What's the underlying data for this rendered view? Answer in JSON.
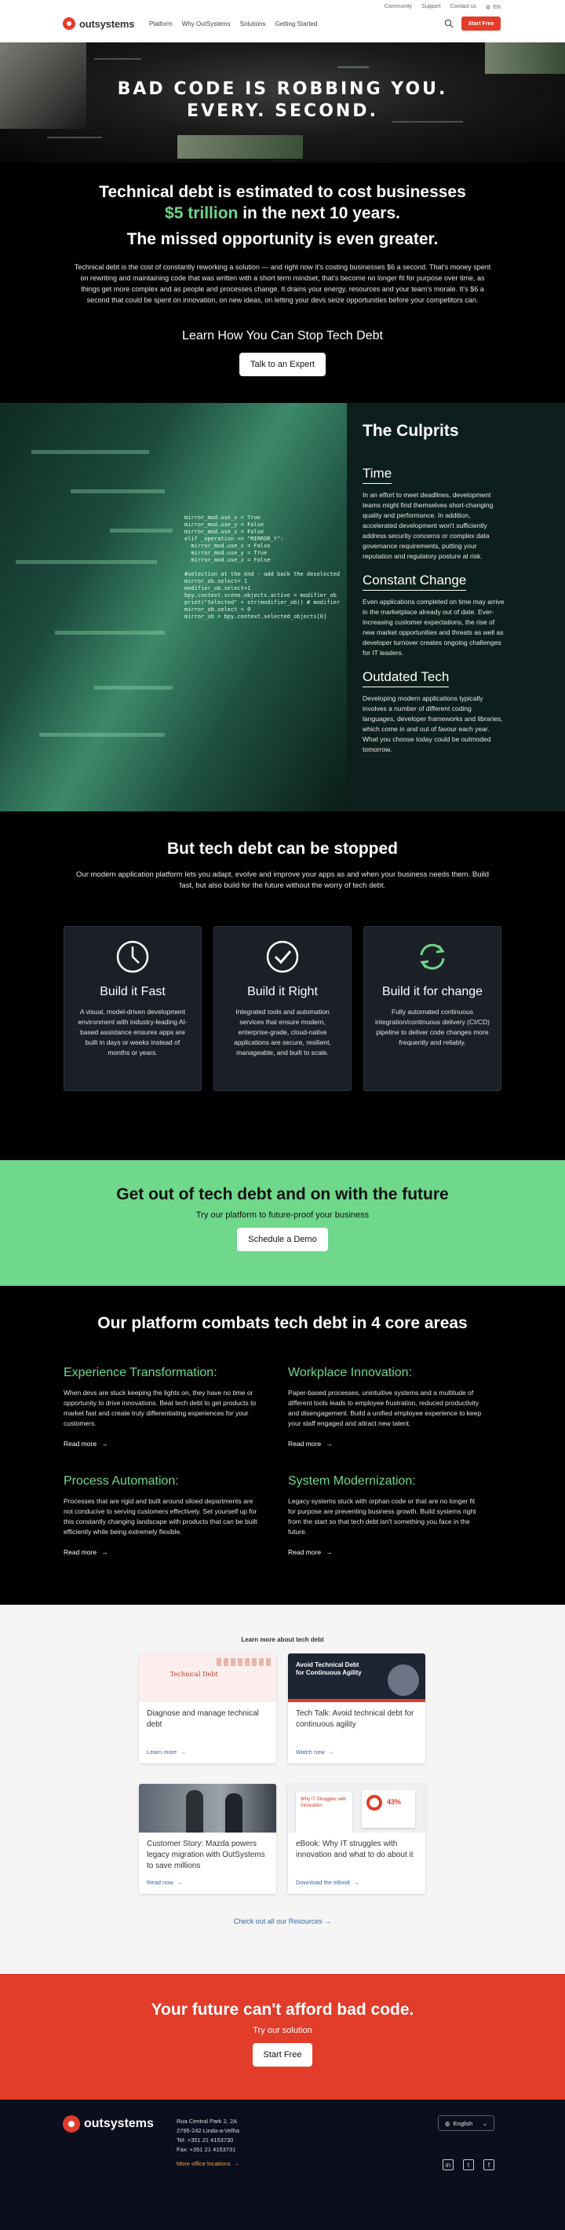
{
  "header": {
    "top_links": [
      "Community",
      "Support",
      "Contact us"
    ],
    "lang": "EN",
    "logo_text": "outsystems",
    "nav": [
      "Platform",
      "Why OutSystems",
      "Solutions",
      "Getting Started"
    ],
    "start_free": "Start Free",
    "brand_color": "#e23c2a"
  },
  "hero": {
    "line1": "BAD CODE IS ROBBING YOU.",
    "line2": "EVERY. SECOND."
  },
  "intro": {
    "headline_a": "Technical debt is estimated to cost businesses",
    "headline_amount": "$5 trillion",
    "headline_b": " in the next 10 years.",
    "subhead": "The missed opportunity is even greater.",
    "body": "Technical debt is the cost of constantly reworking a solution — and right now it's costing businesses $6 a second. That's money spent on rewriting and maintaining code that was written with a short term mindset, that's become no longer fit for purpose over time, as things get more complex and as people and processes change. It drains your energy, resources and your team's morale. It's $6 a second that could be spent on innovation, on new ideas, on letting your devs seize opportunities before your competitors can.",
    "cta_heading": "Learn How You Can Stop Tech Debt",
    "cta_button": "Talk to an Expert"
  },
  "culprits": {
    "title": "The Culprits",
    "items": [
      {
        "heading": "Time",
        "text": "In an effort to meet deadlines, development teams might find themselves short-changing quality and performance. In addition, accelerated development won't sufficiently address security concerns or complex data governance requirements, putting your reputation and regulatory posture at risk."
      },
      {
        "heading": "Constant Change",
        "text": "Even applications completed on time may arrive in the marketplace already out of date. Ever-increasing customer expectations, the rise of new market opportunities and threats as well as developer turnover creates ongoing challenges for IT leaders."
      },
      {
        "heading": "Outdated Tech",
        "text": "Developing modern applications typically involves a number of different coding languages, developer frameworks and libraries, which come in and out of favour each year. What you choose today could be outmoded tomorrow."
      }
    ],
    "code_lines": "mirror_mod.use_x = True\nmirror_mod.use_y = False\nmirror_mod.use_z = False\nelif _operation == \"MIRROR_Y\":\n  mirror_mod.use_x = False\n  mirror_mod.use_y = True\n  mirror_mod.use_z = False\n\n#selection at the end - add back the deselected\nmirror_ob.select= 1\nmodifier_ob.select=1\nbpy.context.scene.objects.active = modifier_ob\nprint(\"Selected\" + str(modifier_ob)) # modifier\nmirror_ob.select = 0\nmirror_ob = bpy.context.selected_objects[0]"
  },
  "stopped": {
    "title": "But tech debt can be stopped",
    "lead": "Our modern application platform lets you adapt, evolve and improve your apps as and when your business needs them. Build fast, but also build for the future without the worry of tech debt.",
    "cards": [
      {
        "icon": "clock-icon",
        "title": "Build it Fast",
        "text": "A visual, model-driven development environment with industry-leading AI-based assistance ensures apps are built in days or weeks instead of months or years."
      },
      {
        "icon": "checkmark-icon",
        "title": "Build it Right",
        "text": "Integrated tools and automation services that ensure modern, enterprise-grade, cloud-native applications are secure, resilient, manageable, and built to scale."
      },
      {
        "icon": "refresh-icon",
        "title": "Build it for change",
        "text": "Fully automated continuous integration/continuous delivery (CI/CD) pipeline to deliver code changes more frequently and reliably."
      }
    ]
  },
  "band": {
    "title": "Get out of tech debt and on with the future",
    "sub": "Try our platform to future-proof your business",
    "button": "Schedule a Demo",
    "color": "#6fd88b"
  },
  "core": {
    "title": "Our platform combats tech debt in 4 core areas",
    "read_more": "Read more",
    "areas": [
      {
        "title": "Experience Transformation:",
        "text": "When devs are stuck keeping the lights on, they have no time or opportunity to drive innovations. Beat tech debt to get products to market fast and create truly differentiating experiences for your customers."
      },
      {
        "title": "Workplace Innovation:",
        "text": "Paper-based processes, unintuitive systems and a multitude of different tools leads to employee frustration, reduced productivity and disengagement. Build a unified employee experience to keep your staff engaged and attract new talent."
      },
      {
        "title": "Process Automation:",
        "text": "Processes that are rigid and built around siloed departments are not conducive to serving customers effectively. Set yourself up for this constantly changing landscape with products that can be built efficiently while being extremely flexible."
      },
      {
        "title": "System Modernization:",
        "text": "Legacy systems stuck with orphan code or that are no longer fit for purpose are preventing business growth. Build systems right from the start so that tech debt isn't something you face in the future."
      }
    ]
  },
  "resources": {
    "heading": "Learn more about tech debt",
    "cards": [
      {
        "title": "Diagnose and manage technical debt",
        "link": "Learn more",
        "thumb_text": "Technical Debt"
      },
      {
        "title": "Tech Talk: Avoid technical debt for continuous agility",
        "link": "Watch now",
        "thumb_text": "Avoid Technical Debt for Continuous Agility"
      },
      {
        "title": "Customer Story: Mazda powers legacy migration with OutSystems to save millions",
        "link": "Read now",
        "thumb_text": ""
      },
      {
        "title": "eBook: Why IT struggles with innovation and what to do about it",
        "link": "Download the eBook",
        "thumb_text": "Why IT Struggles with Innovation",
        "thumb_pct": "43%"
      }
    ],
    "all_link": "Check out all our Resources"
  },
  "redband": {
    "title": "Your future can't afford bad code.",
    "sub": "Try our solution",
    "button": "Start Free"
  },
  "footer": {
    "logo_text": "outsystems",
    "address": [
      "Rua Central Park 2, 2A",
      "2795-242 Linda-a-Velha",
      "Tel: +351 21 4153730",
      "Fax: +351 21 4153731"
    ],
    "offices": "More office locations",
    "language": "English",
    "social": [
      "in",
      "t",
      "f"
    ]
  }
}
